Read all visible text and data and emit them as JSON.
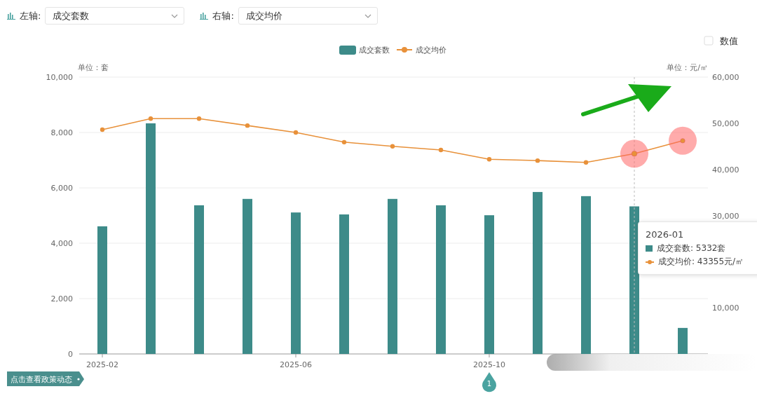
{
  "axis_selectors": [
    {
      "label": "左轴:",
      "value": "成交套数"
    },
    {
      "label": "右轴:",
      "value": "成交均价"
    }
  ],
  "value_toggle": {
    "label": "数值",
    "checked": false
  },
  "chart": {
    "left_unit": "单位：套",
    "right_unit": "单位：元/㎡",
    "chart_data": {
      "type": "bar",
      "ylim": [
        0,
        10000
      ],
      "y2lim": [
        0,
        60000
      ],
      "grid": true,
      "legend": true,
      "categories": [
        "2025-02",
        null,
        null,
        null,
        "2025-06",
        null,
        null,
        null,
        "2025-10",
        null,
        null,
        null,
        null
      ],
      "yticks": [
        {
          "value": 0,
          "label": "0"
        },
        {
          "value": 2000,
          "label": "2,000"
        },
        {
          "value": 4000,
          "label": "4,000"
        },
        {
          "value": 6000,
          "label": "6,000"
        },
        {
          "value": 8000,
          "label": "8,000"
        },
        {
          "value": 10000,
          "label": "10,000"
        }
      ],
      "y2ticks": [
        {
          "value": 60000,
          "label": "60,000"
        },
        {
          "value": 50000,
          "label": "50,000"
        },
        {
          "value": 40000,
          "label": "40,000"
        },
        {
          "value": 30000,
          "label": "30,000"
        },
        {
          "value": 10000,
          "label": "10,000"
        }
      ],
      "series": [
        {
          "name": "成交套数",
          "color": "#3d8b89",
          "type": "bar",
          "values": [
            4610,
            8330,
            5370,
            5600,
            5110,
            5040,
            5600,
            5370,
            5010,
            5850,
            5700,
            5330,
            940
          ]
        },
        {
          "name": "成交均价",
          "color": "#e8913a",
          "type": "line",
          "axis": "y2",
          "marker": "circle",
          "values": [
            48600,
            51000,
            51000,
            49500,
            48000,
            45900,
            45000,
            44200,
            42200,
            41900,
            41500,
            43400,
            46200
          ]
        }
      ]
    },
    "points": [
      {
        "highlighted": false,
        "hovered": false
      },
      {
        "highlighted": false,
        "hovered": false
      },
      {
        "highlighted": false,
        "hovered": false
      },
      {
        "highlighted": false,
        "hovered": false
      },
      {
        "highlighted": false,
        "hovered": false
      },
      {
        "highlighted": false,
        "hovered": false
      },
      {
        "highlighted": false,
        "hovered": false
      },
      {
        "highlighted": false,
        "hovered": false
      },
      {
        "highlighted": false,
        "hovered": false
      },
      {
        "highlighted": false,
        "hovered": false
      },
      {
        "highlighted": false,
        "hovered": false
      },
      {
        "highlighted": true,
        "hovered": true
      },
      {
        "highlighted": true,
        "hovered": false
      }
    ],
    "tooltip": {
      "title": "2026-01",
      "rows": [
        {
          "kind": "bar",
          "text": "成交套数: 5332套"
        },
        {
          "kind": "line",
          "text": "成交均价: 43355元/㎡"
        }
      ]
    },
    "timeline_marker": "1",
    "policy_button": "点击查看政策动态"
  }
}
